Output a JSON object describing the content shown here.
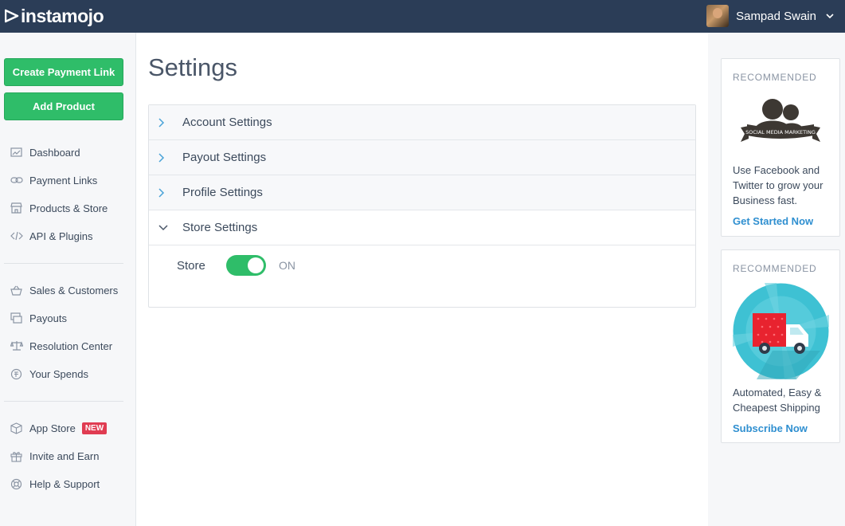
{
  "header": {
    "logo_text": "instamojo",
    "user_name": "Sampad Swain"
  },
  "sidebar": {
    "create_payment_link": "Create Payment Link",
    "add_product": "Add Product",
    "group1": [
      {
        "label": "Dashboard",
        "icon": "chart-icon"
      },
      {
        "label": "Payment Links",
        "icon": "link-icon"
      },
      {
        "label": "Products & Store",
        "icon": "store-icon"
      },
      {
        "label": "API & Plugins",
        "icon": "code-icon"
      }
    ],
    "group2": [
      {
        "label": "Sales & Customers",
        "icon": "basket-icon"
      },
      {
        "label": "Payouts",
        "icon": "payout-icon"
      },
      {
        "label": "Resolution Center",
        "icon": "scale-icon"
      },
      {
        "label": "Your Spends",
        "icon": "spends-icon"
      }
    ],
    "group3": [
      {
        "label": "App Store",
        "icon": "box-icon",
        "badge": "NEW"
      },
      {
        "label": "Invite and Earn",
        "icon": "gift-icon"
      },
      {
        "label": "Help & Support",
        "icon": "lifebuoy-icon"
      }
    ]
  },
  "main": {
    "title": "Settings",
    "sections": [
      {
        "label": "Account Settings",
        "expanded": false
      },
      {
        "label": "Payout Settings",
        "expanded": false
      },
      {
        "label": "Profile Settings",
        "expanded": false
      },
      {
        "label": "Store Settings",
        "expanded": true
      }
    ],
    "store": {
      "label": "Store",
      "state": "ON",
      "enabled": true
    }
  },
  "recommended": [
    {
      "heading": "RECOMMENDED",
      "banner_text": "SOCIAL MEDIA MARKETING",
      "description": "Use Facebook and Twitter to grow your Business fast.",
      "link": "Get Started Now"
    },
    {
      "heading": "RECOMMENDED",
      "description": "Automated, Easy & Cheapest Shipping",
      "link": "Subscribe Now"
    }
  ],
  "colors": {
    "topbar": "#2b3d57",
    "accent_green": "#2fbd69",
    "link_blue": "#2f8fd0",
    "badge_red": "#e03c52"
  }
}
